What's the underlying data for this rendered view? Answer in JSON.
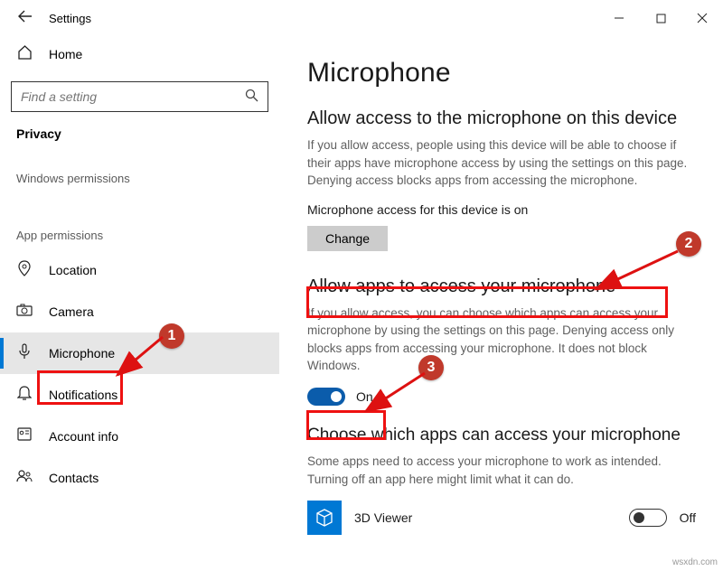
{
  "titlebar": {
    "title": "Settings"
  },
  "sidebar": {
    "home": "Home",
    "search_placeholder": "Find a setting",
    "section": "Privacy",
    "group_windows": "Windows permissions",
    "group_app": "App permissions",
    "items": {
      "location": "Location",
      "camera": "Camera",
      "microphone": "Microphone",
      "notifications": "Notifications",
      "account": "Account info",
      "contacts": "Contacts"
    }
  },
  "main": {
    "heading": "Microphone",
    "allow_device_head": "Allow access to the microphone on this device",
    "allow_device_desc": "If you allow access, people using this device will be able to choose if their apps have microphone access by using the settings on this page. Denying access blocks apps from accessing the microphone.",
    "device_status": "Microphone access for this device is on",
    "change_btn": "Change",
    "allow_apps_head": "Allow apps to access your microphone",
    "allow_apps_desc": "If you allow access, you can choose which apps can access your microphone by using the settings on this page. Denying access only blocks apps from accessing your microphone. It does not block Windows.",
    "toggle_on_label": "On",
    "choose_head": "Choose which apps can access your microphone",
    "choose_desc": "Some apps need to access your microphone to work as intended. Turning off an app here might limit what it can do.",
    "app_3dviewer": "3D Viewer",
    "toggle_off_label": "Off"
  },
  "annotations": {
    "b1": "1",
    "b2": "2",
    "b3": "3"
  },
  "watermark": "wsxdn.com"
}
